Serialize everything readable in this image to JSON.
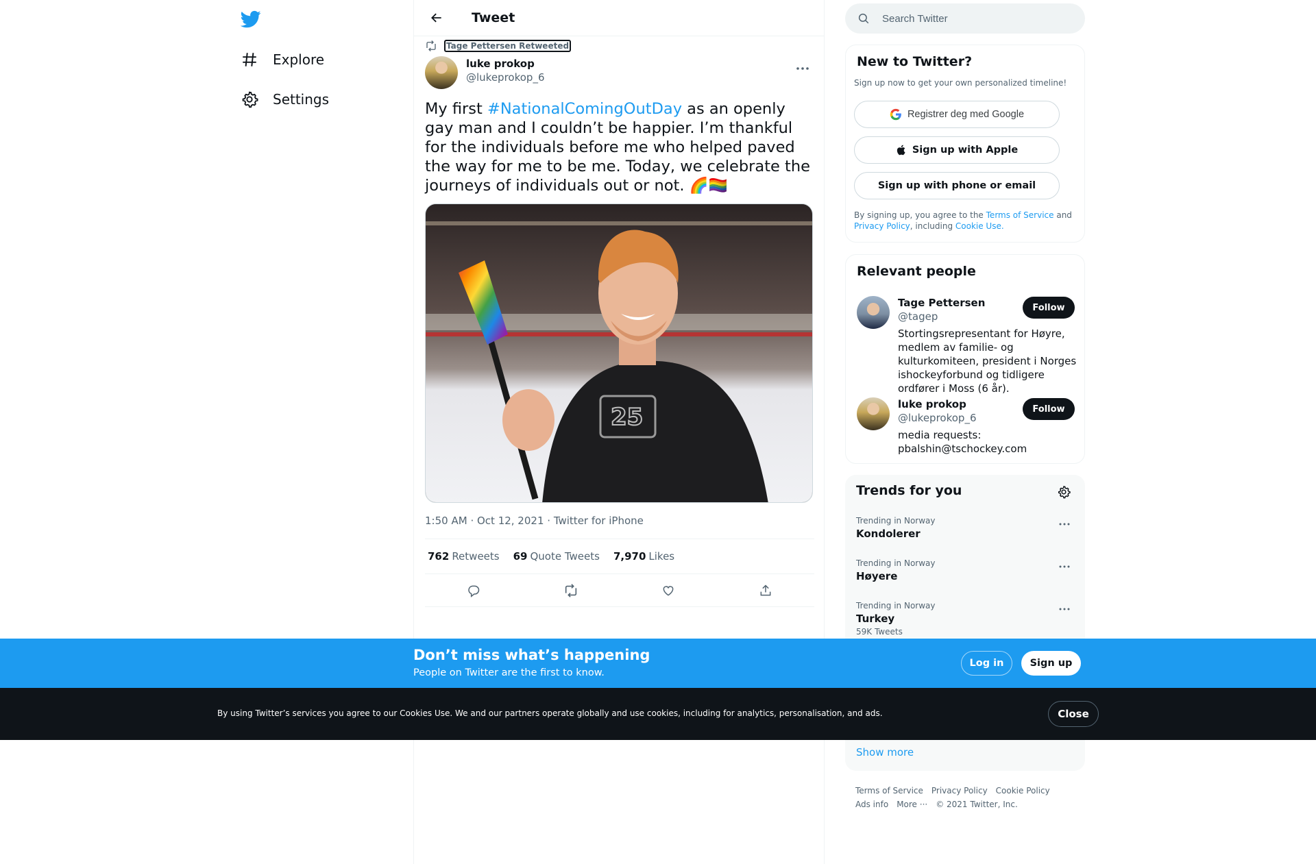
{
  "nav": {
    "explore": "Explore",
    "settings": "Settings"
  },
  "header": {
    "title": "Tweet"
  },
  "tweet": {
    "retweeted_by": "Tage Pettersen Retweeted",
    "author_name": "luke prokop",
    "author_handle": "@lukeprokop_6",
    "text_before": "My first ",
    "hashtag": "#NationalComingOutDay",
    "text_after": " as an openly gay man and I couldn’t be happier. I’m thankful for the individuals before me who helped paved the way for me to be me. Today, we celebrate the journeys of individuals out or not. 🌈🏳️‍🌈",
    "time": "1:50 AM",
    "date": "Oct 12, 2021",
    "source": "Twitter for iPhone",
    "retweets_count": "762",
    "retweets_label": "Retweets",
    "quotes_count": "69",
    "quotes_label": "Quote Tweets",
    "likes_count": "7,970",
    "likes_label": "Likes"
  },
  "search": {
    "placeholder": "Search Twitter"
  },
  "signup": {
    "title": "New to Twitter?",
    "subtitle": "Sign up now to get your own personalized timeline!",
    "google_label": "Registrer deg med Google",
    "apple_label": "Sign up with Apple",
    "phone_label": "Sign up with phone or email",
    "legal_1": "By signing up, you agree to the ",
    "terms": "Terms of Service",
    "legal_2": " and ",
    "privacy": "Privacy Policy",
    "legal_3": ", including ",
    "cookie": "Cookie Use."
  },
  "people": {
    "title": "Relevant people",
    "items": [
      {
        "name": "Tage Pettersen",
        "handle": "@tagep",
        "bio": "Stortingsrepresentant for Høyre, medlem av familie- og kulturkomiteen, president i Norges ishockeyforbund og tidligere ordfører i Moss (6 år).",
        "follow": "Follow"
      },
      {
        "name": "luke prokop",
        "handle": "@lukeprokop_6",
        "bio": "media requests: pbalshin@tschockey.com",
        "follow": "Follow"
      }
    ]
  },
  "trends": {
    "title": "Trends for you",
    "items": [
      {
        "context": "Trending in Norway",
        "name": "Kondolerer",
        "count": ""
      },
      {
        "context": "Trending in Norway",
        "name": "Høyere",
        "count": ""
      },
      {
        "context": "Trending in Norway",
        "name": "Turkey",
        "count": "59K Tweets"
      }
    ],
    "show_more": "Show more"
  },
  "footer": {
    "terms": "Terms of Service",
    "privacy": "Privacy Policy",
    "cookie": "Cookie Policy",
    "ads": "Ads info",
    "more": "More ···",
    "copyright": "© 2021 Twitter, Inc."
  },
  "bottom_bar": {
    "title": "Don’t miss what’s happening",
    "subtitle": "People on Twitter are the first to know.",
    "login": "Log in",
    "signup": "Sign up"
  },
  "cookie_bar": {
    "text": "By using Twitter’s services you agree to our Cookies Use. We and our partners operate globally and use cookies, including for analytics, personalisation, and ads.",
    "close": "Close"
  },
  "colors": {
    "accent": "#1d9bf0",
    "text_primary": "#0f1419",
    "text_secondary": "#536471",
    "cookie_bar_bg": "#0f1419"
  }
}
